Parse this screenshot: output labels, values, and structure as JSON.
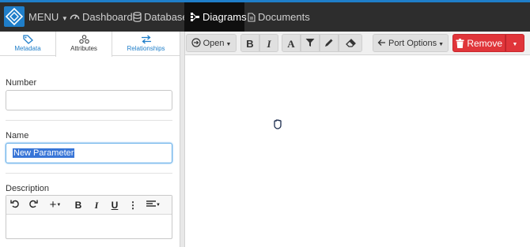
{
  "nav": {
    "menu_label": "MENU",
    "dashboard_label": "Dashboard",
    "database_label": "Database",
    "diagrams_label": "Diagrams",
    "documents_label": "Documents"
  },
  "tabs": [
    {
      "label": "Metadata",
      "icon": "tag-icon"
    },
    {
      "label": "Attributes",
      "icon": "cubes-icon"
    },
    {
      "label": "Relationships",
      "icon": "exchange-icon"
    }
  ],
  "form": {
    "number_label": "Number",
    "number_value": "",
    "name_label": "Name",
    "name_value": "New Parameter",
    "description_label": "Description"
  },
  "toolbar": {
    "open_label": "Open",
    "port_options_label": "Port Options",
    "remove_label": "Remove"
  },
  "colors": {
    "accent": "#1f7ec9",
    "topbar": "#2d2d2d",
    "remove": "#e0353a"
  }
}
